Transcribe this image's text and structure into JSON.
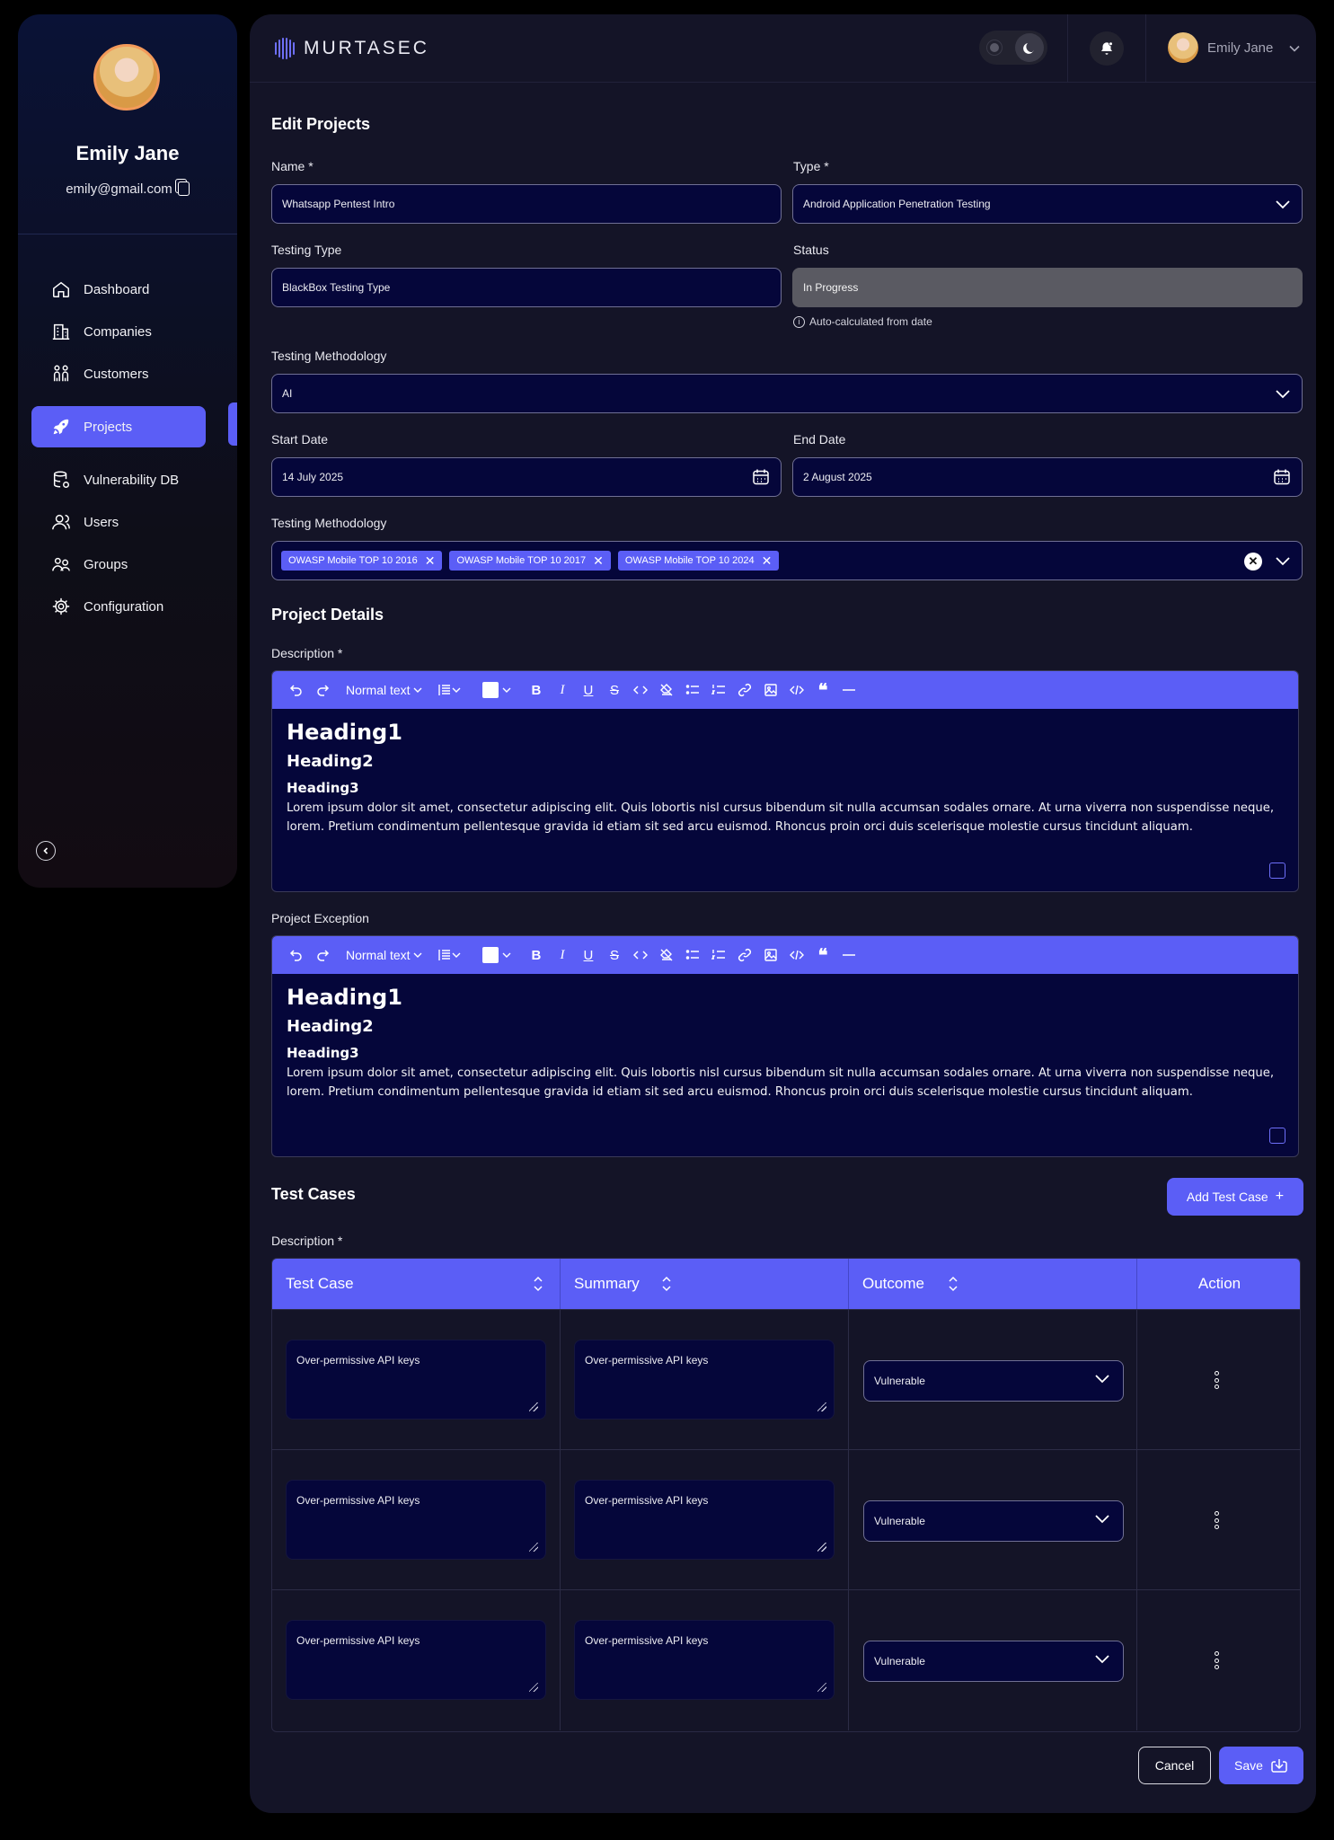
{
  "sidebar": {
    "user_name": "Emily Jane",
    "user_email": "emily@gmail.com",
    "items": [
      {
        "label": "Dashboard",
        "icon": "home-icon"
      },
      {
        "label": "Companies",
        "icon": "building-icon"
      },
      {
        "label": "Customers",
        "icon": "people-icon"
      },
      {
        "label": "Projects",
        "icon": "rocket-icon",
        "active": true
      },
      {
        "label": "Vulnerability DB",
        "icon": "database-icon"
      },
      {
        "label": "Users",
        "icon": "users-icon"
      },
      {
        "label": "Groups",
        "icon": "group-icon"
      },
      {
        "label": "Configuration",
        "icon": "gear-icon"
      }
    ]
  },
  "header": {
    "brand": "MURTASEC",
    "user_name": "Emily Jane"
  },
  "form": {
    "title": "Edit Projects",
    "name_label": "Name *",
    "name_value": "Whatsapp Pentest Intro",
    "type_label": "Type *",
    "type_value": "Android Application Penetration Testing",
    "testing_type_label": "Testing Type",
    "testing_type_value": "BlackBox Testing Type",
    "status_label": "Status",
    "status_value": "In Progress",
    "status_hint": "Auto-calculated from date",
    "methodology_label": "Testing Methodology",
    "methodology_value": "AI",
    "start_label": "Start Date",
    "start_value": "14 July 2025",
    "end_label": "End Date",
    "end_value": "2 August 2025",
    "methodology2_label": "Testing Methodology",
    "tags": [
      "OWASP Mobile TOP 10 2016",
      "OWASP Mobile TOP 10 2017",
      "OWASP Mobile TOP 10 2024"
    ]
  },
  "details": {
    "title": "Project Details",
    "description_label": "Description *",
    "exception_label": "Project Exception",
    "toolbar_text_style": "Normal text",
    "editor": {
      "h1": "Heading1",
      "h2": "Heading2",
      "h3": "Heading3",
      "paragraph": "Lorem ipsum dolor sit amet, consectetur adipiscing elit. Quis lobortis nisl cursus bibendum sit nulla accumsan sodales ornare. At urna viverra non suspendisse neque, lorem. Pretium condimentum pellentesque gravida id etiam sit sed arcu euismod. Rhoncus proin orci duis scelerisque molestie cursus tincidunt aliquam."
    }
  },
  "test_cases": {
    "title": "Test Cases",
    "add_label": "Add Test Case",
    "description_label": "Description *",
    "columns": [
      "Test Case",
      "Summary",
      "Outcome",
      "Action"
    ],
    "rows": [
      {
        "test_case": "Over-permissive API keys",
        "summary": "Over-permissive API keys",
        "outcome": "Vulnerable"
      },
      {
        "test_case": "Over-permissive API keys",
        "summary": "Over-permissive API keys",
        "outcome": "Vulnerable"
      },
      {
        "test_case": "Over-permissive API keys",
        "summary": "Over-permissive API keys",
        "outcome": "Vulnerable"
      }
    ]
  },
  "footer": {
    "cancel_label": "Cancel",
    "save_label": "Save"
  },
  "colors": {
    "accent": "#5b5ef6",
    "background": "#141427",
    "field_bg": "#05063a"
  }
}
